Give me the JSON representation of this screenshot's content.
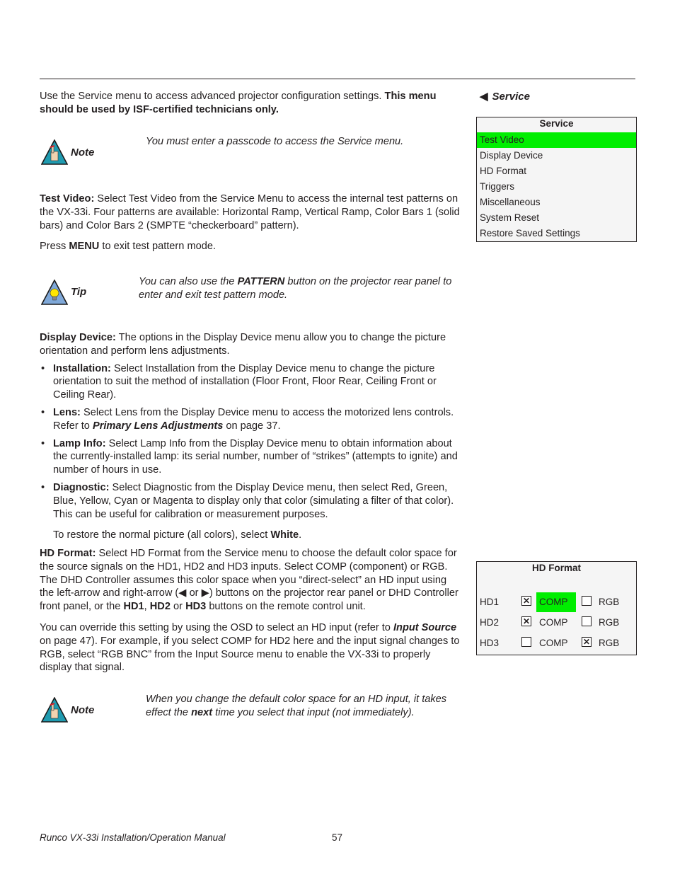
{
  "intro": {
    "text": "Use the Service menu to access advanced projector configuration settings. ",
    "bold": "This menu should be used by ISF-certified technicians only."
  },
  "note1": {
    "label": "Note",
    "text": "You must enter a passcode to access the Service menu."
  },
  "test_video": {
    "heading": "Test Video:",
    "text": " Select Test Video from the Service Menu to access the internal test patterns on the VX-33i. Four patterns are available: Horizontal Ramp, Vertical Ramp, Color Bars 1 (solid bars) and Color Bars 2 (SMPTE “checkerboard” pattern).",
    "press_pre": "Press ",
    "press_bold": "MENU",
    "press_post": " to exit test pattern mode."
  },
  "tip": {
    "label": "Tip",
    "pre": "You can also use the ",
    "bold": "PATTERN",
    "post": " button on the projector rear panel to enter and exit test pattern mode."
  },
  "display_device": {
    "heading": "Display Device:",
    "text": " The options in the Display Device menu allow you to change the picture orientation and perform lens adjustments.",
    "bullets": [
      {
        "term": "Installation:",
        "text": " Select Installation from the Display Device menu to change the picture orientation to suit the method of installation (Floor Front, Floor Rear, Ceiling Front or Ceiling Rear)."
      },
      {
        "term": "Lens:",
        "text": " Select Lens from the Display Device menu to access the motorized lens controls. Refer to ",
        "link": "Primary Lens Adjustments",
        "post": " on page 37."
      },
      {
        "term": "Lamp Info:",
        "text": " Select Lamp Info from the Display Device menu to obtain information about the currently-installed lamp: its serial number, number of “strikes” (attempts to ignite) and number of hours in use."
      },
      {
        "term": "Diagnostic:",
        "text": " Select Diagnostic from the Display Device menu, then select Red, Green, Blue, Yellow, Cyan or Magenta to display only that color (simulating a filter of that color). This can be useful for calibration or measurement purposes."
      }
    ],
    "restore_pre": "To restore the normal picture (all colors), select ",
    "restore_bold": "White",
    "restore_post": "."
  },
  "hd_format": {
    "heading": "HD Format:",
    "text1": " Select HD Format from the Service menu to choose the default color space for the source signals on the HD1, HD2 and HD3 inputs. Select COMP (component) or RGB. The DHD Controller assumes this color space when you “direct-select” an HD input using the left-arrow and right-arrow (",
    "left_arrow": "◀",
    "or": " or ",
    "right_arrow": "▶",
    "text2": ") buttons on the projector rear panel or DHD Controller front panel, or the ",
    "hd1": "HD1",
    "comma": ", ",
    "hd2": "HD2",
    "or2": " or ",
    "hd3": "HD3",
    "text3": " buttons on the remote control unit.",
    "override_pre": "You can override this setting by using the OSD to select an HD input (refer to ",
    "override_link": "Input Source",
    "override_post": " on page 47). For example, if you select COMP for HD2 here and the input signal changes to RGB, select “RGB BNC” from the Input Source menu to enable the VX-33i to properly display that signal."
  },
  "note2": {
    "label": "Note",
    "pre": "When you change the default color space for an HD input, it takes effect the ",
    "bold": "next",
    "post": " time you select that input (not immediately)."
  },
  "side_heading": {
    "arrow": "◀",
    "title": "Service"
  },
  "service_menu": {
    "title": "Service",
    "items": [
      "Test Video",
      "Display Device",
      "HD Format",
      "Triggers",
      "Miscellaneous",
      "System Reset",
      "Restore Saved Settings"
    ],
    "selected_index": 0,
    "highlight_color": "#00ee00"
  },
  "hd_format_menu": {
    "title": "HD Format",
    "rows": [
      {
        "name": "HD1",
        "comp_checked": true,
        "comp_label": "COMP",
        "rgb_checked": false,
        "rgb_label": "RGB",
        "comp_highlight": true
      },
      {
        "name": "HD2",
        "comp_checked": true,
        "comp_label": "COMP",
        "rgb_checked": false,
        "rgb_label": "RGB",
        "comp_highlight": false
      },
      {
        "name": "HD3",
        "comp_checked": false,
        "comp_label": "COMP",
        "rgb_checked": true,
        "rgb_label": "RGB",
        "comp_highlight": false
      }
    ],
    "check_mark": "✕"
  },
  "footer": {
    "title": "Runco VX-33i Installation/Operation Manual",
    "page": "57"
  }
}
